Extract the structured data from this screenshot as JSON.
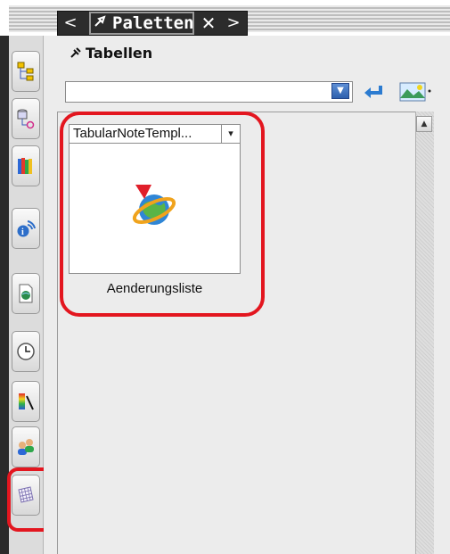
{
  "header": {
    "title": "Paletten",
    "nav_back": "<",
    "nav_forward": ">",
    "close": "✕"
  },
  "palette": {
    "section_title": "Tabellen",
    "combo_value": ""
  },
  "card": {
    "template": "TabularNoteTempl...",
    "caption": "Aenderungsliste"
  },
  "tools": [
    {
      "name": "hierarchy-icon"
    },
    {
      "name": "database-icon"
    },
    {
      "name": "books-icon"
    },
    {
      "name": "info-wireless-icon"
    },
    {
      "name": "document-globe-icon"
    },
    {
      "name": "clock-icon"
    },
    {
      "name": "color-ramp-icon"
    },
    {
      "name": "users-icon"
    },
    {
      "name": "table-grid-icon"
    }
  ],
  "colors": {
    "highlight": "#e3161f",
    "header_dark": "#2c2c2c",
    "combo_arrow": "#2d5fad"
  }
}
